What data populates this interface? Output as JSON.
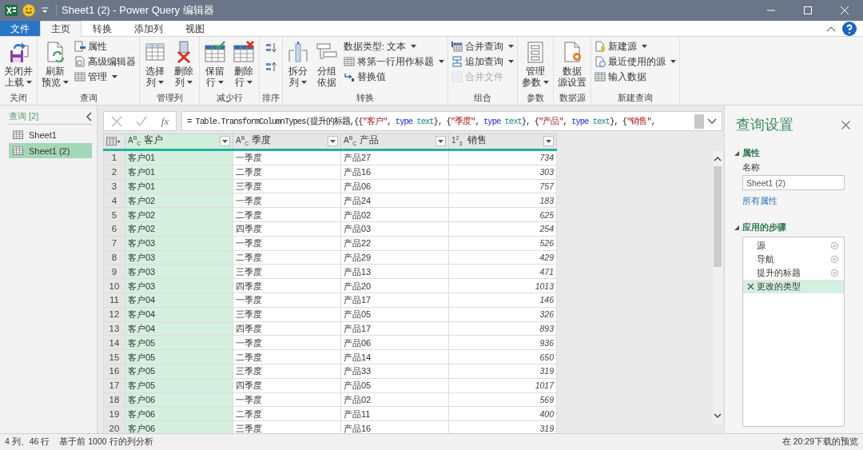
{
  "window": {
    "title": "Sheet1 (2) - Power Query 编辑器"
  },
  "ribbon_tabs": [
    {
      "label": "文件",
      "kind": "file",
      "selected": false
    },
    {
      "label": "主页",
      "kind": "tab",
      "selected": true
    },
    {
      "label": "转换",
      "kind": "tab",
      "selected": false
    },
    {
      "label": "添加列",
      "kind": "tab",
      "selected": false
    },
    {
      "label": "视图",
      "kind": "tab",
      "selected": false
    }
  ],
  "ribbon_groups": [
    {
      "label": "关闭",
      "buttons": [
        {
          "kind": "large",
          "lines": [
            "关闭并",
            "上载"
          ],
          "dropdown": true,
          "disabled": false
        }
      ]
    },
    {
      "label": "查询",
      "buttons": [
        {
          "kind": "large",
          "lines": [
            "刷新",
            "预览"
          ],
          "dropdown": true,
          "disabled": false
        },
        {
          "kind": "small",
          "lines": [
            "属性"
          ],
          "dropdown": false,
          "disabled": false
        },
        {
          "kind": "small",
          "lines": [
            "高级编辑器"
          ],
          "dropdown": false,
          "disabled": false
        },
        {
          "kind": "small",
          "lines": [
            "管理"
          ],
          "dropdown": true,
          "disabled": false
        }
      ]
    },
    {
      "label": "管理列",
      "buttons": [
        {
          "kind": "large",
          "lines": [
            "选择",
            "列"
          ],
          "dropdown": true,
          "disabled": false
        },
        {
          "kind": "large",
          "lines": [
            "删除",
            "列"
          ],
          "dropdown": true,
          "disabled": false
        }
      ]
    },
    {
      "label": "减少行",
      "buttons": [
        {
          "kind": "large",
          "lines": [
            "保留",
            "行"
          ],
          "dropdown": true,
          "disabled": false
        },
        {
          "kind": "large",
          "lines": [
            "删除",
            "行"
          ],
          "dropdown": true,
          "disabled": false
        }
      ]
    },
    {
      "label": "排序",
      "buttons": [
        {
          "kind": "icon",
          "dropdown": false,
          "disabled": false
        },
        {
          "kind": "icon",
          "dropdown": false,
          "disabled": false
        }
      ]
    },
    {
      "label": "转换",
      "buttons": [
        {
          "kind": "large",
          "lines": [
            "拆分",
            "列"
          ],
          "dropdown": true,
          "disabled": false
        },
        {
          "kind": "large",
          "lines": [
            "分组",
            "依据"
          ],
          "dropdown": false,
          "disabled": false
        },
        {
          "kind": "small",
          "lines": [
            "数据类型: 文本"
          ],
          "dropdown": true,
          "disabled": false
        },
        {
          "kind": "small",
          "lines": [
            "将第一行用作标题"
          ],
          "dropdown": true,
          "disabled": false
        },
        {
          "kind": "small",
          "lines": [
            "替换值"
          ],
          "dropdown": false,
          "disabled": false
        }
      ]
    },
    {
      "label": "组合",
      "buttons": [
        {
          "kind": "small",
          "lines": [
            "合并查询"
          ],
          "dropdown": true,
          "disabled": false
        },
        {
          "kind": "small",
          "lines": [
            "追加查询"
          ],
          "dropdown": true,
          "disabled": false
        },
        {
          "kind": "small",
          "lines": [
            "合并文件"
          ],
          "dropdown": false,
          "disabled": true
        }
      ]
    },
    {
      "label": "参数",
      "buttons": [
        {
          "kind": "large",
          "lines": [
            "管理",
            "参数"
          ],
          "dropdown": true,
          "disabled": false
        }
      ]
    },
    {
      "label": "数据源",
      "buttons": [
        {
          "kind": "large",
          "lines": [
            "数据",
            "源设置"
          ],
          "dropdown": false,
          "disabled": false
        }
      ]
    },
    {
      "label": "新建查询",
      "buttons": [
        {
          "kind": "small",
          "lines": [
            "新建源"
          ],
          "dropdown": true,
          "disabled": false
        },
        {
          "kind": "small",
          "lines": [
            "最近使用的源"
          ],
          "dropdown": true,
          "disabled": false
        },
        {
          "kind": "small",
          "lines": [
            "输入数据"
          ],
          "dropdown": false,
          "disabled": false
        }
      ]
    }
  ],
  "queries_pane": {
    "header": "查询 [2]",
    "items": [
      {
        "label": "Sheet1",
        "selected": false
      },
      {
        "label": "Sheet1 (2)",
        "selected": true
      }
    ]
  },
  "formula_bar": {
    "fx_label": "fx",
    "segments": [
      {
        "kind": "plain",
        "text": "= Table.TransformColumnTypes(提升的标题,{{"
      },
      {
        "kind": "string",
        "text": "\"客户\""
      },
      {
        "kind": "plain",
        "text": ", "
      },
      {
        "kind": "keyword",
        "text": "type"
      },
      {
        "kind": "type",
        "text": " text"
      },
      {
        "kind": "plain",
        "text": "}, {"
      },
      {
        "kind": "string",
        "text": "\"季度\""
      },
      {
        "kind": "plain",
        "text": ", "
      },
      {
        "kind": "keyword",
        "text": "type"
      },
      {
        "kind": "type",
        "text": " text"
      },
      {
        "kind": "plain",
        "text": "}, {"
      },
      {
        "kind": "string",
        "text": "\"产品\""
      },
      {
        "kind": "plain",
        "text": ", "
      },
      {
        "kind": "keyword",
        "text": "type"
      },
      {
        "kind": "type",
        "text": " text"
      },
      {
        "kind": "plain",
        "text": "}, {"
      },
      {
        "kind": "string",
        "text": "\"销售\""
      },
      {
        "kind": "plain",
        "text": ","
      }
    ]
  },
  "table": {
    "columns": [
      {
        "name": "客户",
        "type_label": "A$^{B}$$_{C}$",
        "kind": "text",
        "selected": true
      },
      {
        "name": "季度",
        "type_label": "A$^{B}$$_{C}$",
        "kind": "text",
        "selected": false
      },
      {
        "name": "产品",
        "type_label": "A$^{B}$$_{C}$",
        "kind": "text",
        "selected": false
      },
      {
        "name": "销售",
        "type_label": "1$^{2}$$_{3}$",
        "kind": "number",
        "selected": false
      }
    ],
    "rows": [
      {
        "number": "1",
        "cells": [
          "客户01",
          "一季度",
          "产品27",
          "734"
        ]
      },
      {
        "number": "2",
        "cells": [
          "客户01",
          "二季度",
          "产品16",
          "303"
        ]
      },
      {
        "number": "3",
        "cells": [
          "客户01",
          "三季度",
          "产品06",
          "757"
        ]
      },
      {
        "number": "4",
        "cells": [
          "客户02",
          "一季度",
          "产品24",
          "183"
        ]
      },
      {
        "number": "5",
        "cells": [
          "客户02",
          "二季度",
          "产品02",
          "625"
        ]
      },
      {
        "number": "6",
        "cells": [
          "客户02",
          "四季度",
          "产品03",
          "254"
        ]
      },
      {
        "number": "7",
        "cells": [
          "客户03",
          "一季度",
          "产品22",
          "526"
        ]
      },
      {
        "number": "8",
        "cells": [
          "客户03",
          "二季度",
          "产品29",
          "429"
        ]
      },
      {
        "number": "9",
        "cells": [
          "客户03",
          "三季度",
          "产品13",
          "471"
        ]
      },
      {
        "number": "10",
        "cells": [
          "客户03",
          "四季度",
          "产品20",
          "1013"
        ]
      },
      {
        "number": "11",
        "cells": [
          "客户04",
          "一季度",
          "产品17",
          "146"
        ]
      },
      {
        "number": "12",
        "cells": [
          "客户04",
          "三季度",
          "产品05",
          "326"
        ]
      },
      {
        "number": "13",
        "cells": [
          "客户04",
          "四季度",
          "产品17",
          "893"
        ]
      },
      {
        "number": "14",
        "cells": [
          "客户05",
          "一季度",
          "产品06",
          "936"
        ]
      },
      {
        "number": "15",
        "cells": [
          "客户05",
          "二季度",
          "产品14",
          "650"
        ]
      },
      {
        "number": "16",
        "cells": [
          "客户05",
          "三季度",
          "产品33",
          "319"
        ]
      },
      {
        "number": "17",
        "cells": [
          "客户05",
          "四季度",
          "产品05",
          "1017"
        ]
      },
      {
        "number": "18",
        "cells": [
          "客户06",
          "一季度",
          "产品02",
          "569"
        ]
      },
      {
        "number": "19",
        "cells": [
          "客户06",
          "二季度",
          "产品11",
          "400"
        ]
      },
      {
        "number": "20",
        "cells": [
          "客户06",
          "三季度",
          "产品16",
          "319"
        ]
      }
    ]
  },
  "query_settings": {
    "title": "查询设置",
    "properties": {
      "heading": "属性",
      "expanded": true,
      "name_label": "名称",
      "name_value": "Sheet1 (2)",
      "all_properties_link": "所有属性"
    },
    "applied_steps": {
      "heading": "应用的步骤",
      "expanded": true,
      "steps": [
        {
          "label": "源",
          "has_settings": true,
          "selected": false
        },
        {
          "label": "导航",
          "has_settings": true,
          "selected": false
        },
        {
          "label": "提升的标题",
          "has_settings": true,
          "selected": false
        },
        {
          "label": "更改的类型",
          "has_settings": false,
          "selected": true
        }
      ]
    }
  },
  "status_bar": {
    "left": [
      "4 列、46 行",
      "基于前 1000 行的列分析"
    ],
    "right": "在 20:29下载的预览"
  }
}
